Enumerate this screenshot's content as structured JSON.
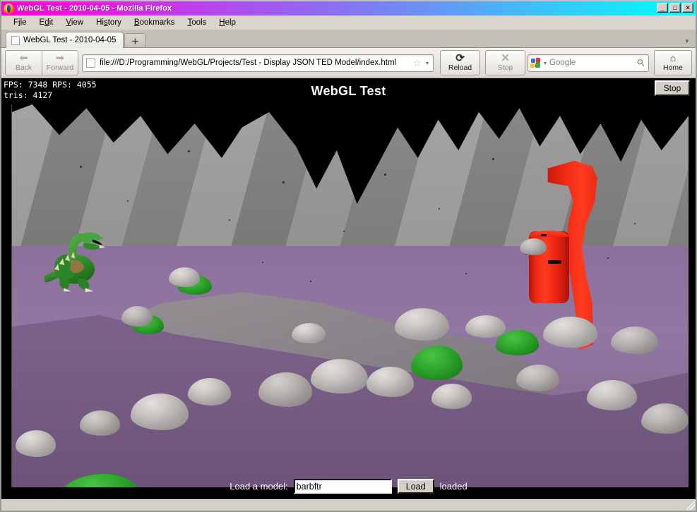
{
  "window": {
    "title": "WebGL Test - 2010-04-05 - Mozilla Firefox",
    "minimize_label": "_",
    "maximize_label": "□",
    "close_label": "✕"
  },
  "menubar": {
    "items": [
      {
        "label": "File",
        "pre": "F",
        "mnemonic": "i",
        "post": "le"
      },
      {
        "label": "Edit",
        "pre": "E",
        "mnemonic": "d",
        "post": "it"
      },
      {
        "label": "View",
        "pre": "",
        "mnemonic": "V",
        "post": "iew"
      },
      {
        "label": "History",
        "pre": "Hi",
        "mnemonic": "s",
        "post": "tory"
      },
      {
        "label": "Bookmarks",
        "pre": "",
        "mnemonic": "B",
        "post": "ookmarks"
      },
      {
        "label": "Tools",
        "pre": "",
        "mnemonic": "T",
        "post": "ools"
      },
      {
        "label": "Help",
        "pre": "",
        "mnemonic": "H",
        "post": "elp"
      }
    ]
  },
  "tabs": {
    "items": [
      {
        "label": "WebGL Test - 2010-04-05"
      }
    ],
    "new_tab_label": "+",
    "tab_list_arrow": "▾"
  },
  "toolbar": {
    "back_label": "Back",
    "back_icon": "⬅",
    "forward_label": "Forward",
    "forward_icon": "➡",
    "reload_label": "Reload",
    "reload_icon": "⟳",
    "stop_label": "Stop",
    "stop_icon": "✕",
    "home_label": "Home",
    "home_icon": "⌂"
  },
  "urlbar": {
    "value": "file:///D:/Programming/WebGL/Projects/Test - Display JSON TED Model/index.html",
    "star_icon": "☆",
    "dropdown_icon": "▾"
  },
  "searchbar": {
    "placeholder": "Google",
    "engine_dropdown_icon": "▾",
    "search_icon": "⚲"
  },
  "page": {
    "heading": "WebGL Test",
    "stop_button_label": "Stop",
    "stats": {
      "line1": "FPS: 7348 RPS: 4055",
      "line2": "tris: 4127",
      "fps": 7348,
      "rps": 4055,
      "tris": 4127
    },
    "controls": {
      "load_label": "Load a model:",
      "model_value": "barbftr",
      "model_placeholder": "",
      "load_button_label": "Load",
      "status": "loaded"
    }
  },
  "scene": {
    "description": "WebGL 3D scene: green dragon model on purple terrain with gray jagged mountains, green bushes, gray rocks, a red cylinder and a red curved ribbon",
    "colors": {
      "sky": "#000000",
      "mountain": "#878787",
      "ground_purple": "#8d6f9c",
      "ground_purple_dark": "#6d5379",
      "rock_light": "#d8d6d4",
      "bush_green": "#2fa52c",
      "model_green": "#2f8f2a",
      "red_object": "#ef2a13",
      "canvas_border": "#4a4a4a"
    }
  }
}
